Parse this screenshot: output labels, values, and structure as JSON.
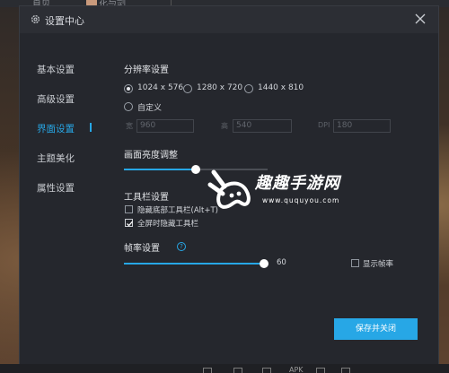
{
  "window": {
    "title": "设置中心"
  },
  "background_tabs": {
    "home": "首页",
    "tab": "花与剑"
  },
  "sidebar": {
    "items": [
      {
        "label": "基本设置",
        "active": false
      },
      {
        "label": "高级设置",
        "active": false
      },
      {
        "label": "界面设置",
        "active": true
      },
      {
        "label": "主题美化",
        "active": false
      },
      {
        "label": "属性设置",
        "active": false
      }
    ]
  },
  "resolution": {
    "title": "分辨率设置",
    "options": [
      {
        "label": "1024 x 576",
        "checked": true
      },
      {
        "label": "1280 x 720",
        "checked": false
      },
      {
        "label": "1440 x 810",
        "checked": false
      }
    ],
    "custom_label": "自定义",
    "width_label": "宽",
    "width_value": "960",
    "height_label": "高",
    "height_value": "540",
    "dpi_label": "DPI",
    "dpi_value": "180"
  },
  "brightness": {
    "title": "画面亮度调整",
    "level": 0.5
  },
  "toolbar": {
    "title": "工具栏设置",
    "options": [
      {
        "label": "隐藏底部工具栏(Alt+T)",
        "checked": false
      },
      {
        "label": "全屏时隐藏工具栏",
        "checked": true
      }
    ]
  },
  "framerate": {
    "title": "帧率设置",
    "help_glyph": "?",
    "value": "60",
    "level": 1.0,
    "show_fps_label": "显示帧率",
    "show_fps_checked": false
  },
  "actions": {
    "save_label": "保存并关闭"
  },
  "watermark": {
    "text": "趣趣手游网",
    "url": "www.ququyou.com"
  },
  "taskbar": {
    "apk_label": "APK"
  },
  "colors": {
    "accent": "#27a7e6",
    "dialog_bg": "#25272d",
    "header_bg": "#2c2e34"
  }
}
